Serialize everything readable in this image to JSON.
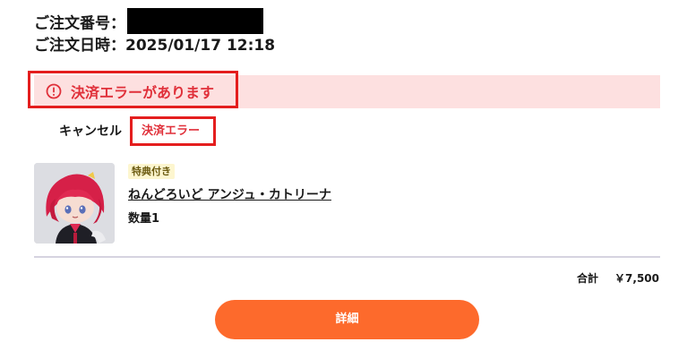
{
  "order": {
    "number_label": "ご注文番号：",
    "date_label": "ご注文日時：",
    "date_value": "2025/01/17 12:18"
  },
  "error_banner": {
    "text": "決済エラーがあります",
    "icon": "alert-circle-icon",
    "background_color": "#fde0e0",
    "text_color": "#e0303a"
  },
  "status": {
    "cancel_label": "キャンセル",
    "error_label": "決済エラー"
  },
  "product": {
    "badge": "特典付き",
    "name": "ねんどろいど アンジュ・カトリーナ",
    "quantity_label": "数量",
    "quantity_value": "1"
  },
  "total": {
    "label": "合計",
    "value": "￥7,500"
  },
  "actions": {
    "detail_button": "詳細",
    "button_color": "#fd6a2c"
  },
  "annotation_color": "#e41e1e"
}
